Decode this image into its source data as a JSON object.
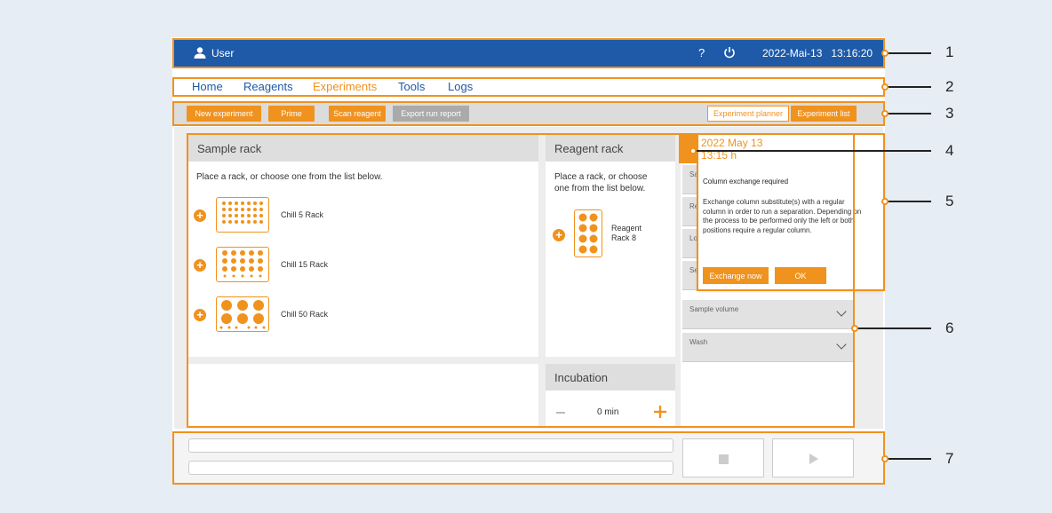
{
  "topbar": {
    "user_label": "User",
    "help_label": "?",
    "datetime": "2022-Mai-13   13:16:20"
  },
  "nav": {
    "items": [
      "Home",
      "Reagents",
      "Experiments",
      "Tools",
      "Logs"
    ],
    "active": "Experiments"
  },
  "toolbar": {
    "new_experiment": "New experiment",
    "prime": "Prime",
    "scan_reagent": "Scan reagent",
    "export_run_report": "Export run report",
    "experiment_planner": "Experiment planner",
    "experiment_list": "Experiment list"
  },
  "sample_rack": {
    "title": "Sample rack",
    "instructions": "Place a rack, or choose one from the list below.",
    "racks": [
      "Chill 5 Rack",
      "Chill 15 Rack",
      "Chill 50 Rack"
    ]
  },
  "reagent_rack": {
    "title": "Reagent rack",
    "instructions_line1": "Place a rack, or choose",
    "instructions_line2": "one from the list below.",
    "rack_line1": "Reagent",
    "rack_line2": "Rack 8"
  },
  "incubation": {
    "title": "Incubation",
    "value": "0 min"
  },
  "settings": {
    "partial_labels": [
      "Sa",
      "Re",
      "Lo",
      "Se"
    ],
    "sample_volume": "Sample volume",
    "wash": "Wash"
  },
  "popup": {
    "date": "2022 May 13",
    "time": "13:15 h",
    "title": "Column exchange required",
    "body": "Exchange column substitute(s) with a regular column in order to run a separation. Depending on the process to be performed only the left or both positions require a regular column.",
    "exchange_now": "Exchange now",
    "ok": "OK"
  },
  "callouts": [
    "1",
    "2",
    "3",
    "4",
    "5",
    "6",
    "7"
  ],
  "colors": {
    "accent": "#f0921e",
    "brand": "#1e5aa8"
  }
}
